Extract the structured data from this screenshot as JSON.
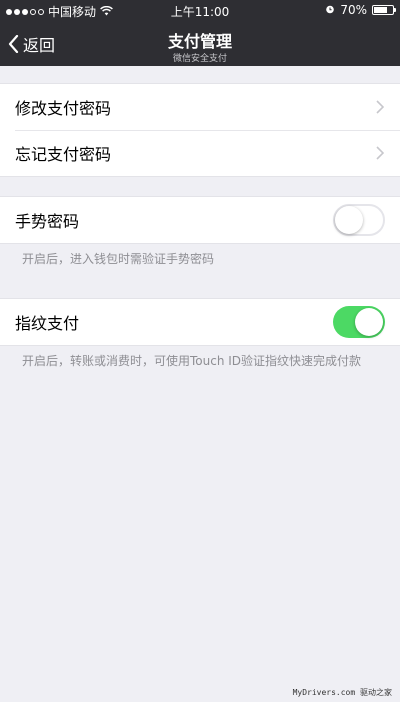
{
  "status_bar": {
    "carrier": "中国移动",
    "time": "上午11:00",
    "battery_percent": "70%",
    "battery_level": 0.7,
    "icons": [
      "signal-dots-icon",
      "wifi-icon",
      "alarm-icon",
      "battery-icon"
    ]
  },
  "nav": {
    "back_label": "返回",
    "title": "支付管理",
    "subtitle": "微信安全支付"
  },
  "password_group": {
    "items": [
      {
        "label": "修改支付密码"
      },
      {
        "label": "忘记支付密码"
      }
    ]
  },
  "gesture": {
    "label": "手势密码",
    "enabled": false,
    "hint": "开启后，进入钱包时需验证手势密码"
  },
  "fingerprint": {
    "label": "指纹支付",
    "enabled": true,
    "hint": "开启后，转账或消费时，可使用Touch ID验证指纹快速完成付款"
  },
  "watermark": "MyDrivers.com 驱动之家",
  "colors": {
    "bar_background": "#2e2e33",
    "page_background": "#efeff4",
    "toggle_on": "#4cd964"
  }
}
